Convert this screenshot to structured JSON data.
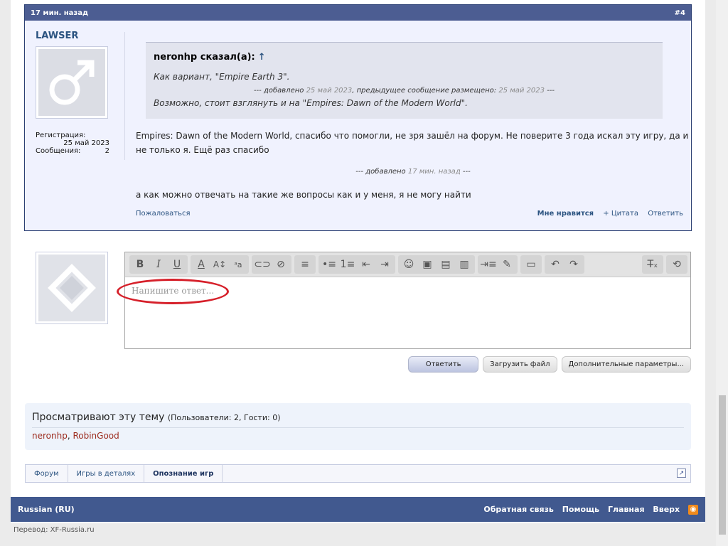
{
  "post": {
    "time": "17 мин. назад",
    "number": "#4",
    "author": {
      "name": "LAWSER",
      "reg_label": "Регистрация:",
      "reg_date": "25 май 2023",
      "messages_label": "Сообщения:",
      "messages_count": "2"
    },
    "quote": {
      "author": "neronhp сказал(а):",
      "arrow": "↑",
      "line1": "Как вариант, \"Empire Earth 3\".",
      "added_prefix": "--- добавлено ",
      "added_date": "25 май 2023",
      "added_mid": ", предыдущее сообщение размещено: ",
      "prev_date": "25 май 2023",
      "added_suffix": " ---",
      "line2": "Возможно, стоит взглянуть и на \"Empires: Dawn of the Modern World\"."
    },
    "text1": "Empires: Dawn of the Modern World, спасибо что помогли, не зря зашёл на форум. Не поверите 3 года искал эту игру, да и не только я. Ещё раз спасибо",
    "added2_prefix": "--- добавлено ",
    "added2_time": "17 мин. назад",
    "added2_suffix": " ---",
    "text2": "а как можно отвечать на такие же вопросы как и у меня, я не могу найти",
    "report": "Пожаловаться",
    "like": "Мне нравится",
    "quote_action": "+ Цитата",
    "reply_action": "Ответить"
  },
  "editor": {
    "placeholder": "Напишите ответ..."
  },
  "buttons": {
    "reply": "Ответить",
    "upload": "Загрузить файл",
    "more": "Дополнительные параметры..."
  },
  "viewers": {
    "title": "Просматривают эту тему",
    "counts": "(Пользователи: 2, Гости: 0)",
    "user1": "neronhp",
    "sep": ", ",
    "user2": "RobinGood"
  },
  "breadcrumb": [
    "Форум",
    "Игры в деталях",
    "Опознание игр"
  ],
  "footer": {
    "language": "Russian (RU)",
    "links": [
      "Обратная связь",
      "Помощь",
      "Главная",
      "Вверх"
    ],
    "credit": "Перевод: XF-Russia.ru"
  },
  "colors": {
    "header": "#4c5d92",
    "footer": "#41598f",
    "highlight": "#d6202a"
  }
}
